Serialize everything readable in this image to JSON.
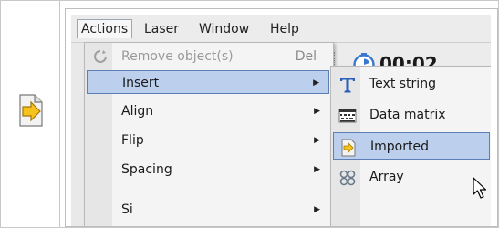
{
  "menubar": {
    "items": [
      "Actions",
      "Laser",
      "Window",
      "Help"
    ],
    "active": "Actions"
  },
  "toolbar": {
    "timer": "00:02",
    "timer_icon": "clock-icon"
  },
  "actions_menu": {
    "items": [
      {
        "label": "Remove object(s)",
        "shortcut": "Del",
        "disabled": true,
        "icon": "remove-icon"
      },
      {
        "label": "Insert",
        "submenu": true,
        "highlighted": true
      },
      {
        "label": "Align",
        "submenu": true
      },
      {
        "label": "Flip",
        "submenu": true
      },
      {
        "label": "Spacing",
        "submenu": true
      },
      {
        "label": "Si",
        "submenu": true
      }
    ]
  },
  "insert_submenu": {
    "items": [
      {
        "label": "Text string",
        "icon": "text-t-icon"
      },
      {
        "label": "Data matrix",
        "icon": "data-matrix-icon"
      },
      {
        "label": "Imported",
        "icon": "imported-file-icon",
        "highlighted": true
      },
      {
        "label": "Array",
        "icon": "array-icon"
      }
    ]
  },
  "side_icon": "imported-document-icon",
  "colors": {
    "highlight_bg": "#bcd0ee",
    "highlight_border": "#5d7fb5",
    "text_icon_blue": "#2b5fb8",
    "timer_blue": "#3a78d0"
  }
}
